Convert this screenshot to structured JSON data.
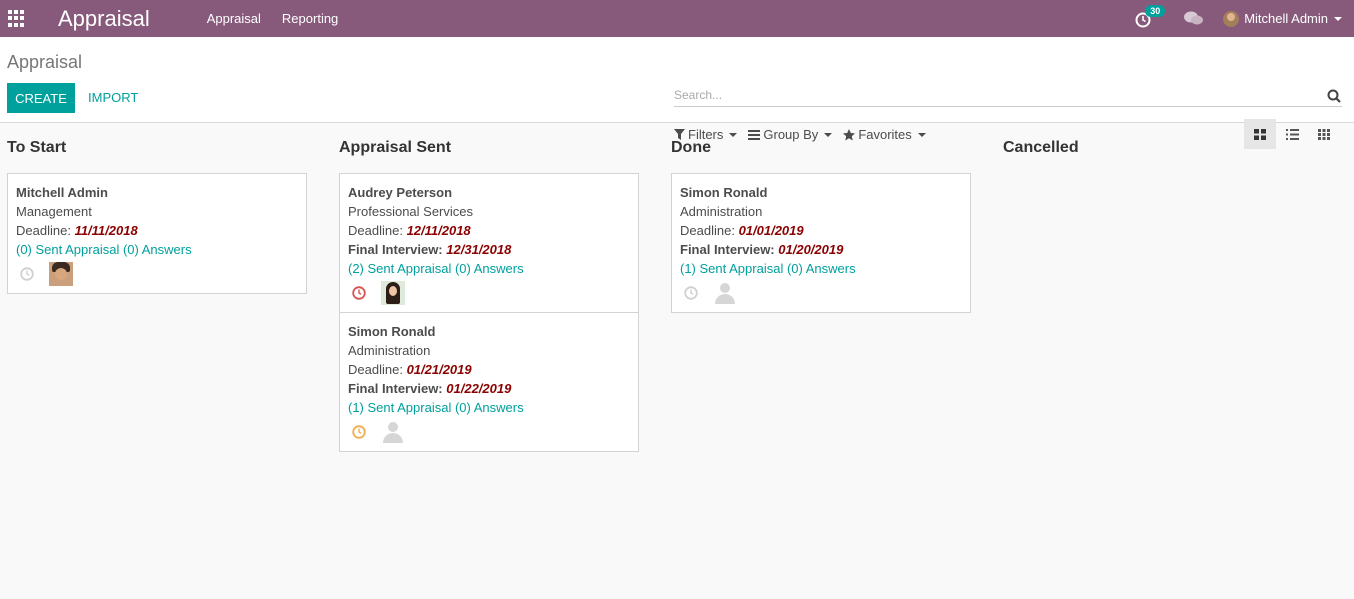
{
  "navbar": {
    "brand": "Appraisal",
    "menu": [
      "Appraisal",
      "Reporting"
    ],
    "activity_count": "30",
    "user_name": "Mitchell Admin"
  },
  "control_panel": {
    "breadcrumb": "Appraisal",
    "create_label": "CREATE",
    "import_label": "IMPORT",
    "search_placeholder": "Search...",
    "filters_label": "Filters",
    "groupby_label": "Group By",
    "favorites_label": "Favorites"
  },
  "columns": [
    {
      "title": "To Start",
      "cards": [
        {
          "name": "Mitchell Admin",
          "department": "Management",
          "deadline_label": "Deadline:",
          "deadline": "11/11/2018",
          "interview_label": "",
          "interview": "",
          "link": "(0) Sent Appraisal (0) Answers",
          "clock_color": "#d0d0d0",
          "avatar": "man"
        }
      ]
    },
    {
      "title": "Appraisal Sent",
      "cards": [
        {
          "name": "Audrey Peterson",
          "department": "Professional Services",
          "deadline_label": "Deadline:",
          "deadline": "12/11/2018",
          "interview_label": "Final Interview:",
          "interview": "12/31/2018",
          "link": "(2) Sent Appraisal (0) Answers",
          "clock_color": "#d9534f",
          "avatar": "woman"
        },
        {
          "name": "Simon Ronald",
          "department": "Administration",
          "deadline_label": "Deadline:",
          "deadline": "01/21/2019",
          "interview_label": "Final Interview:",
          "interview": "01/22/2019",
          "link": "(1) Sent Appraisal (0) Answers",
          "clock_color": "#f0ad4e",
          "avatar": "placeholder"
        }
      ]
    },
    {
      "title": "Done",
      "cards": [
        {
          "name": "Simon Ronald",
          "department": "Administration",
          "deadline_label": "Deadline:",
          "deadline": "01/01/2019",
          "interview_label": "Final Interview:",
          "interview": "01/20/2019",
          "link": "(1) Sent Appraisal (0) Answers",
          "clock_color": "#d0d0d0",
          "avatar": "placeholder"
        }
      ]
    },
    {
      "title": "Cancelled",
      "cards": []
    }
  ]
}
